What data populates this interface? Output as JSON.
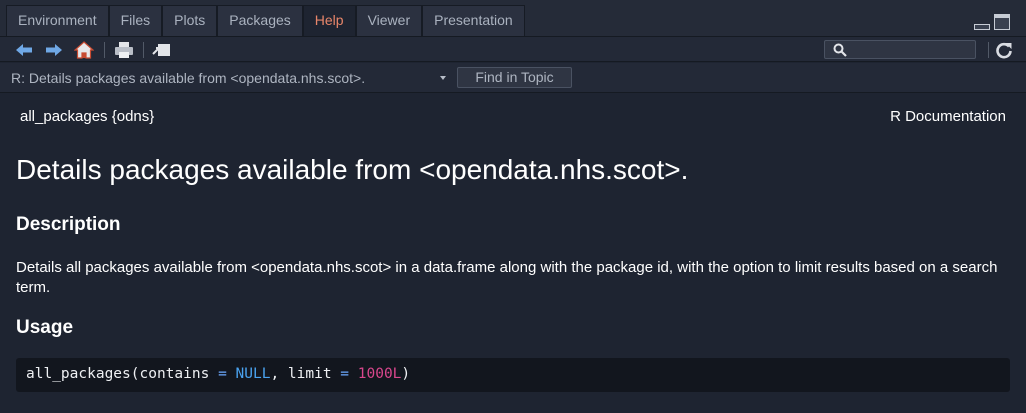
{
  "tabs": [
    {
      "label": "Environment",
      "active": false
    },
    {
      "label": "Files",
      "active": false
    },
    {
      "label": "Plots",
      "active": false
    },
    {
      "label": "Packages",
      "active": false
    },
    {
      "label": "Help",
      "active": true
    },
    {
      "label": "Viewer",
      "active": false
    },
    {
      "label": "Presentation",
      "active": false
    }
  ],
  "toolbar": {
    "icons": [
      "back-arrow-icon",
      "forward-arrow-icon",
      "home-icon",
      "print-icon",
      "popout-icon",
      "search-icon",
      "refresh-icon"
    ],
    "search_value": ""
  },
  "topic": {
    "title": "R: Details packages available from <opendata.nhs.scot>.",
    "find_label": "Find in Topic"
  },
  "doc": {
    "header_left": "all_packages {odns}",
    "header_right": "R Documentation",
    "title": "Details packages available from <opendata.nhs.scot>.",
    "description_heading": "Description",
    "description_text": "Details all packages available from <opendata.nhs.scot> in a data.frame along with the package id, with the option to limit results based on a search term.",
    "usage_heading": "Usage",
    "usage_code": {
      "fn": "all_packages(contains ",
      "op1": "=",
      "null": "NULL",
      "mid": ", limit ",
      "op2": "=",
      "num": "1000L",
      "end": ")"
    }
  },
  "colors": {
    "accent_active_tab": "#e8866a",
    "background": "#1e2431",
    "code_background": "#12161e",
    "code_number": "#d9478d",
    "code_null": "#4aa3f0"
  }
}
